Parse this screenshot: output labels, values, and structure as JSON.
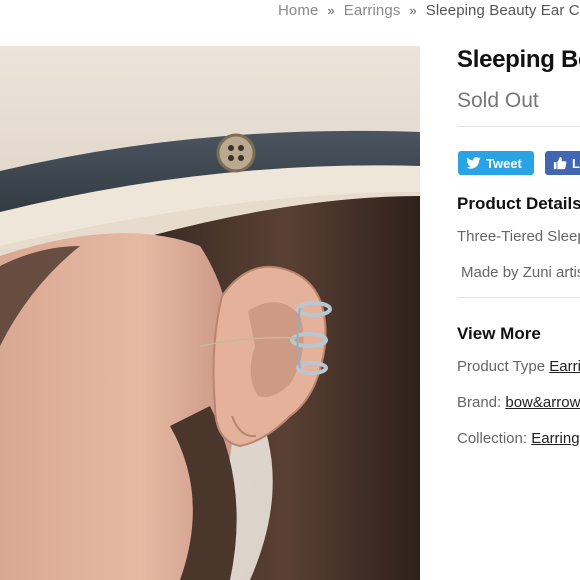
{
  "breadcrumb": {
    "home": "Home",
    "separator": "»",
    "category": "Earrings",
    "current": "Sleeping Beauty Ear Cuff"
  },
  "product": {
    "image_alt": "Ear cuff product photo",
    "title": "Sleeping Beauty Ear Cuff",
    "status": "Sold Out"
  },
  "share": {
    "tweet_label": "Tweet",
    "like_label": "Like",
    "twitter_color": "#2aa3e5",
    "facebook_color": "#4267b2"
  },
  "details": {
    "heading": "Product Details",
    "description": "Three-Tiered Sleeping Beauty Ear Cuff",
    "made_by": "Made by Zuni artisans"
  },
  "view_more": {
    "heading": "View More",
    "type_label": "Product Type",
    "type_value": "Earrings",
    "brand_label": "Brand:",
    "brand_value": "bow&arrow",
    "collection_label": "Collection:",
    "collection_value": "Earrings"
  }
}
